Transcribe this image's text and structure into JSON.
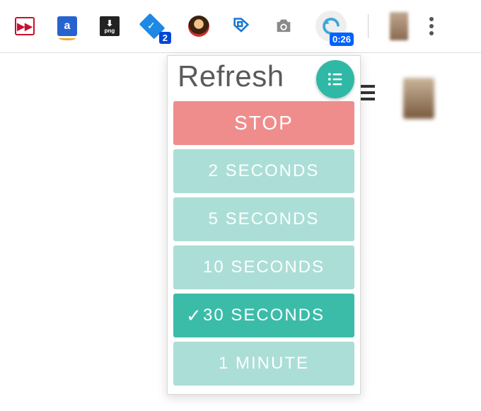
{
  "toolbar": {
    "inbox_badge": "2",
    "png_label": "png",
    "amazon_letter": "a",
    "timer": "0:26"
  },
  "popup": {
    "title": "Refresh",
    "stop_label": "STOP",
    "options": [
      {
        "label": "2 SECONDS",
        "selected": false
      },
      {
        "label": "5 SECONDS",
        "selected": false
      },
      {
        "label": "10 SECONDS",
        "selected": false
      },
      {
        "label": "30 SECONDS",
        "selected": true
      },
      {
        "label": "1 MINUTE",
        "selected": false
      }
    ]
  },
  "colors": {
    "accent": "#2fb8a5",
    "stop": "#ef8d8d",
    "interval": "#abded7",
    "selected": "#3bbca9",
    "badge_blue": "#0062ff"
  }
}
